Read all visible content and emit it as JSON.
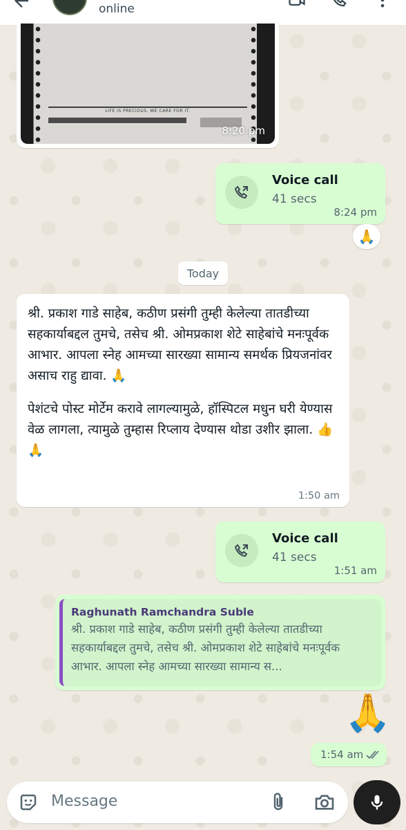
{
  "header": {
    "status": "online",
    "back_icon": "arrow-left-icon",
    "video_icon": "video-call-icon",
    "call_icon": "phone-add-icon",
    "menu_icon": "more-vert-icon"
  },
  "messages": {
    "image_msg": {
      "time": "8:20 pm",
      "paper_tagline": "LIFE IS PRECIOUS. WE CARE FOR IT."
    },
    "call1": {
      "title": "Voice call",
      "duration": "41 secs",
      "time": "8:24 pm"
    },
    "reaction1": "🙏",
    "date_chip": "Today",
    "incoming_text": {
      "para1": "श्री. प्रकाश गाडे साहेब, कठीण प्रसंगी तुम्ही केलेल्या तातडीच्या सहकार्याबद्दल तुमचे, तसेच श्री. ओमप्रकाश शेटे साहेबांचे मनःपूर्वक आभार. आपला स्नेह आमच्या सारख्या सामान्य समर्थक प्रियजनांवर असाच राहु द्यावा. 🙏",
      "para2": "पेशंटचे पोस्ट मोर्टेम करावे लागल्यामुळे, हॉस्पिटल मधुन घरी येण्यास वेळ लागला, त्यामुळे तुम्हास रिप्लाय देण्यास थोडा उशीर झाला. 👍🙏",
      "time": "1:50 am"
    },
    "call2": {
      "title": "Voice call",
      "duration": "41 secs",
      "time": "1:51 am"
    },
    "reply": {
      "quoted_author": "Raghunath Ramchandra Suble",
      "quoted_text": "श्री. प्रकाश गाडे साहेब, कठीण प्रसंगी तुम्ही केलेल्या तातडीच्या सहकार्याबद्दल तुमचे, तसेच श्री. ओमप्रकाश शेटे साहेबांचे मनःपूर्वक आभार. आपला स्नेह आमच्या सारख्या सामान्य स..."
    },
    "big_emoji": "🙏",
    "sent_time": "1:54 am"
  },
  "input": {
    "placeholder": "Message"
  },
  "colors": {
    "outgoing": "#d9fdd3",
    "incoming": "#ffffff",
    "wallpaper": "#efeae2",
    "quote_bar": "#8a4fc6",
    "mic_button": "#1f1f1f"
  }
}
